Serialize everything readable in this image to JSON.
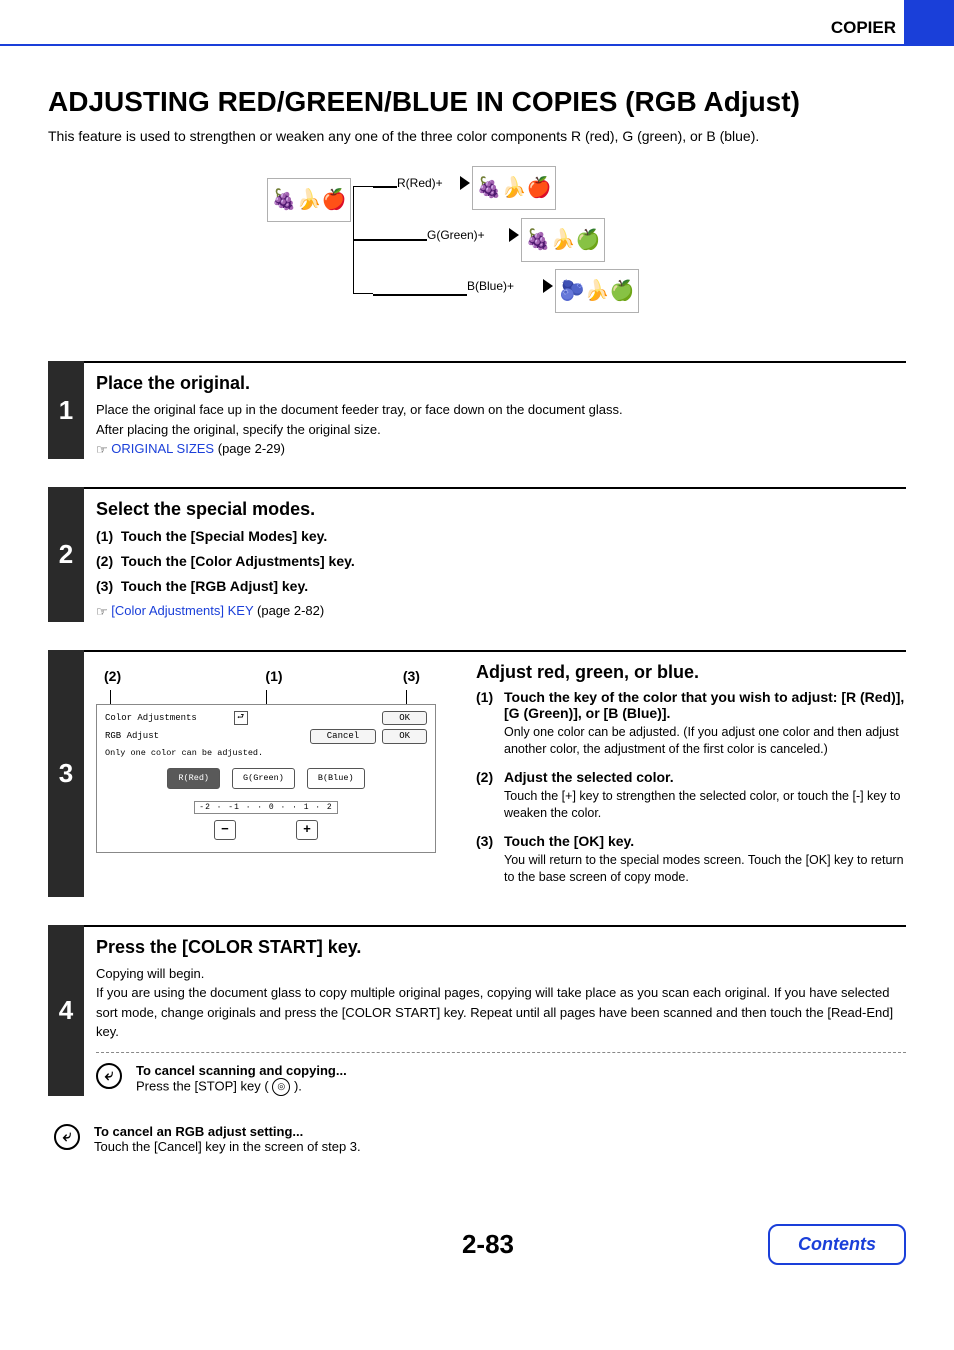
{
  "header": {
    "section": "COPIER"
  },
  "title": "ADJUSTING RED/GREEN/BLUE IN COPIES (RGB Adjust)",
  "intro": "This feature is used to strengthen or weaken any one of the three color components R (red), G (green), or B (blue).",
  "diagram": {
    "rLabel": "R(Red)+",
    "gLabel": "G(Green)+",
    "bLabel": "B(Blue)+"
  },
  "step1": {
    "num": "1",
    "title": "Place the original.",
    "body1": "Place the original face up in the document feeder tray, or face down on the document glass.",
    "body2": "After placing the original, specify the original size.",
    "linkText": "ORIGINAL SIZES",
    "linkPage": "(page 2-29)"
  },
  "step2": {
    "num": "2",
    "title": "Select the special modes.",
    "item1": "Touch the [Special Modes] key.",
    "item2": "Touch the [Color Adjustments] key.",
    "item3": "Touch the [RGB Adjust] key.",
    "linkText": "[Color Adjustments] KEY",
    "linkPage": "(page 2-82)"
  },
  "step3": {
    "num": "3",
    "callouts": {
      "c1": "(2)",
      "c2": "(1)",
      "c3": "(3)"
    },
    "panel": {
      "breadcrumb": "Color Adjustments",
      "subtitle": "RGB Adjust",
      "okTop": "OK",
      "cancel": "Cancel",
      "ok": "OK",
      "info": "Only one color can be adjusted.",
      "r": "R(Red)",
      "g": "G(Green)",
      "b": "B(Blue)",
      "scale": "-2 · -1 · · 0 · · 1 · 2",
      "minus": "−",
      "plus": "+"
    },
    "right": {
      "title": "Adjust red, green, or blue.",
      "item1Head": "Touch the key of the color that you wish to adjust: [R (Red)], [G (Green)], or [B (Blue)].",
      "item1Body": "Only one color can be adjusted. (If you adjust one color and then adjust another color, the adjustment of the first color is canceled.)",
      "item2Head": "Adjust the selected color.",
      "item2Body": "Touch the [+] key to strengthen the selected color, or touch the [-] key to weaken the color.",
      "item3Head": "Touch the [OK] key.",
      "item3Body": "You will return to the special modes screen. Touch the [OK] key to return to the base screen of copy mode."
    }
  },
  "step4": {
    "num": "4",
    "title": "Press the [COLOR START] key.",
    "body1": "Copying will begin.",
    "body2": "If you are using the document glass to copy multiple original pages, copying will take place as you scan each original. If you have selected sort mode, change originals and press the [COLOR START] key. Repeat until all pages have been scanned and then touch the [Read-End] key.",
    "cancelTitle": "To cancel scanning and copying...",
    "cancelBody1": "Press the [STOP] key (",
    "cancelBody2": ")."
  },
  "footNote": {
    "title": "To cancel an RGB adjust setting...",
    "body": "Touch the [Cancel] key in the screen of step 3."
  },
  "footer": {
    "pageNum": "2-83",
    "contents": "Contents"
  },
  "labels": {
    "n1": "(1)",
    "n2": "(2)",
    "n3": "(3)"
  }
}
